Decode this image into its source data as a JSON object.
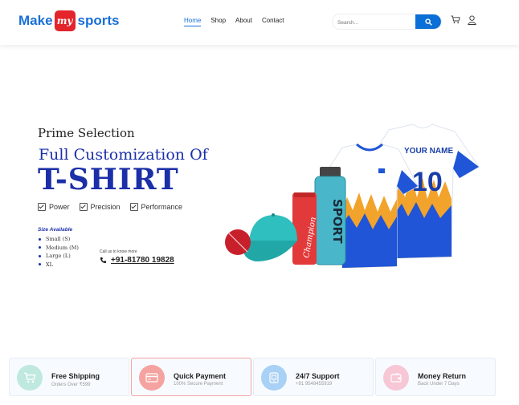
{
  "header": {
    "logo": {
      "make": "Make",
      "my": "my",
      "sports": "sports"
    },
    "nav": [
      {
        "label": "Home",
        "active": true
      },
      {
        "label": "Shop"
      },
      {
        "label": "About"
      },
      {
        "label": "Contact"
      }
    ],
    "search": {
      "placeholder": "Search..."
    },
    "icons": [
      "search-icon",
      "cart-icon",
      "user-icon"
    ],
    "accent": "#1a6fd6"
  },
  "hero": {
    "kicker": "Prime Selection",
    "headline": "Full Customization Of",
    "product": "T-SHIRT",
    "features": [
      "Power",
      "Precision",
      "Performance"
    ],
    "size_title": "Size Available",
    "sizes": [
      "Small (S)",
      "Medium (M)",
      "Large (L)",
      "XL"
    ],
    "call_label": "Call us to know more",
    "phone": "+91-81780 19828",
    "jersey_name": "YOUR NAME",
    "jersey_number": "10",
    "bottle_text": "SPORT",
    "can_text": "Champion"
  },
  "services": [
    {
      "title": "Free Shipping",
      "subtitle": "Orders Over ₹599",
      "icon": "cart-icon",
      "color": "#bfe8de"
    },
    {
      "title": "Quick Payment",
      "subtitle": "100% Secure Payment",
      "icon": "card-icon",
      "color": "#f5a3a0"
    },
    {
      "title": "24/7 Support",
      "subtitle": "+91 9548455919",
      "icon": "phone-icon",
      "color": "#a9d0f5"
    },
    {
      "title": "Money Return",
      "subtitle": "Back Under 7 Days",
      "icon": "wallet-icon",
      "color": "#f7c7d6"
    }
  ]
}
